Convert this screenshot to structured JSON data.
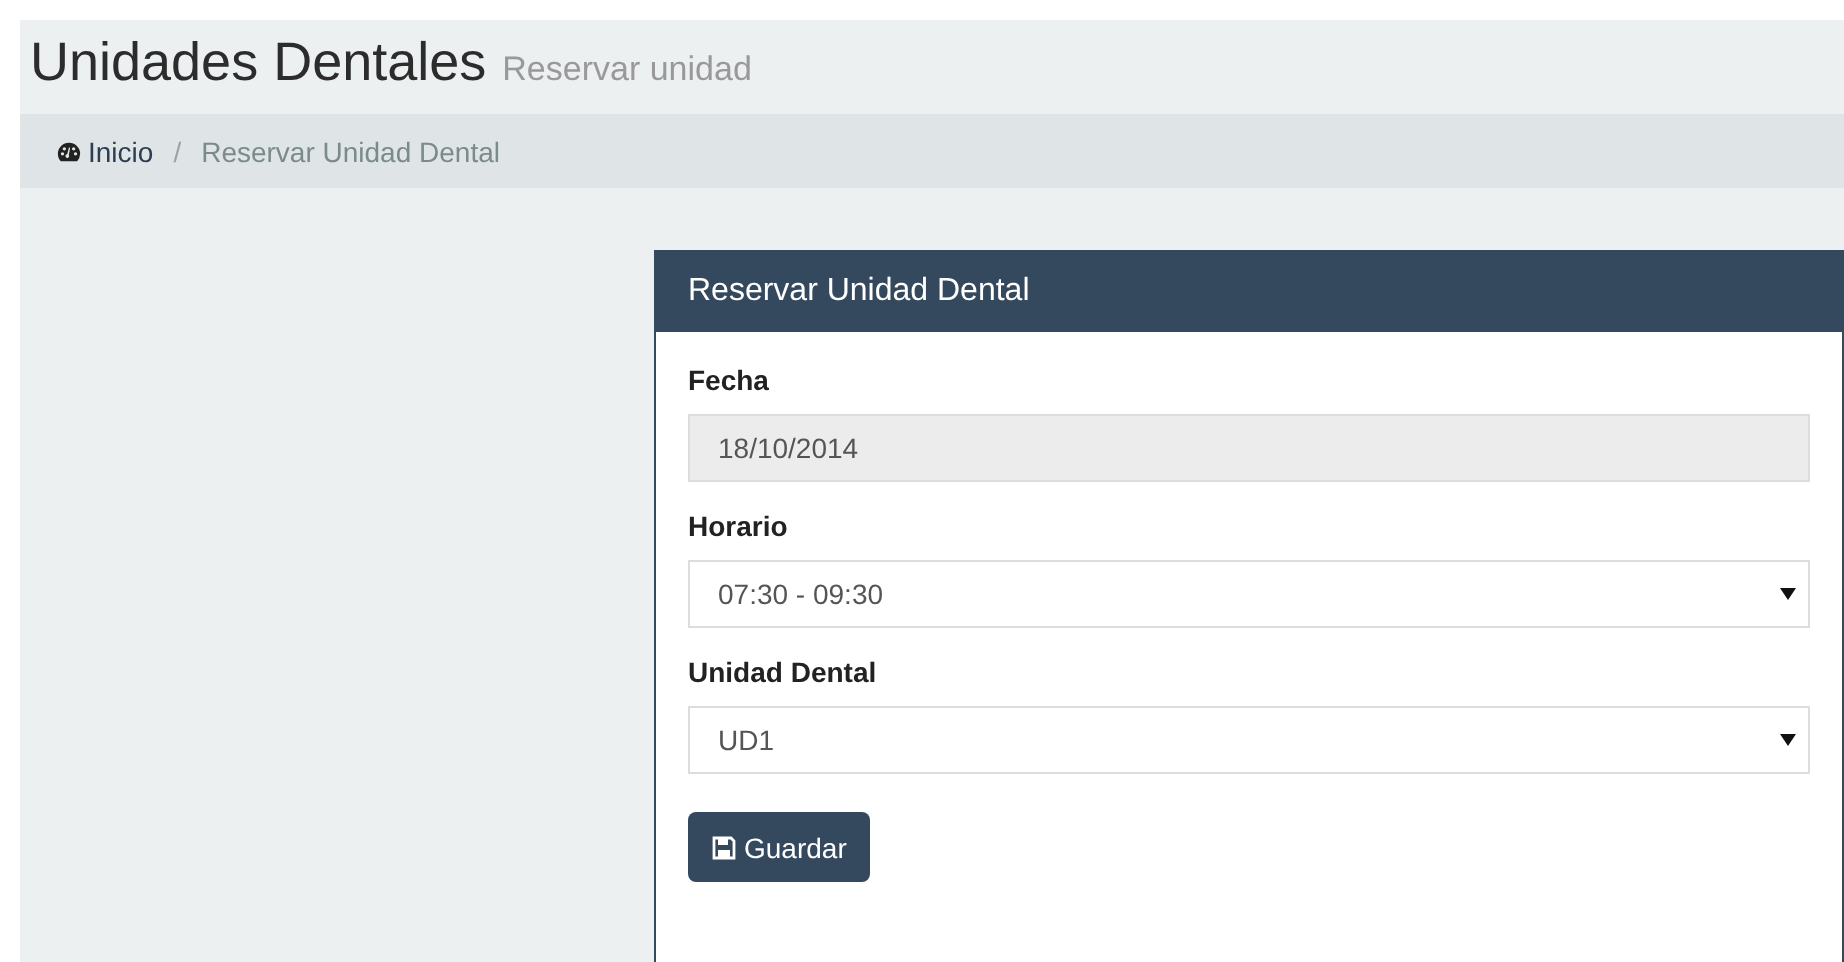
{
  "header": {
    "title": "Unidades Dentales",
    "subtitle": "Reservar unidad"
  },
  "breadcrumb": [
    {
      "label": "Inicio"
    },
    {
      "label": "Reservar Unidad Dental",
      "separator": "/"
    }
  ],
  "panel": {
    "title": "Reservar Unidad Dental",
    "fields": [
      {
        "label": "Fecha",
        "kind": "text",
        "value": "18/10/2014",
        "disabled": true
      },
      {
        "label": "Horario",
        "kind": "select",
        "value": "07:30 - 09:30",
        "disabled": false
      },
      {
        "label": "Unidad Dental",
        "kind": "select",
        "value": "UD1",
        "disabled": false
      }
    ],
    "button": {
      "label": "Guardar"
    }
  }
}
